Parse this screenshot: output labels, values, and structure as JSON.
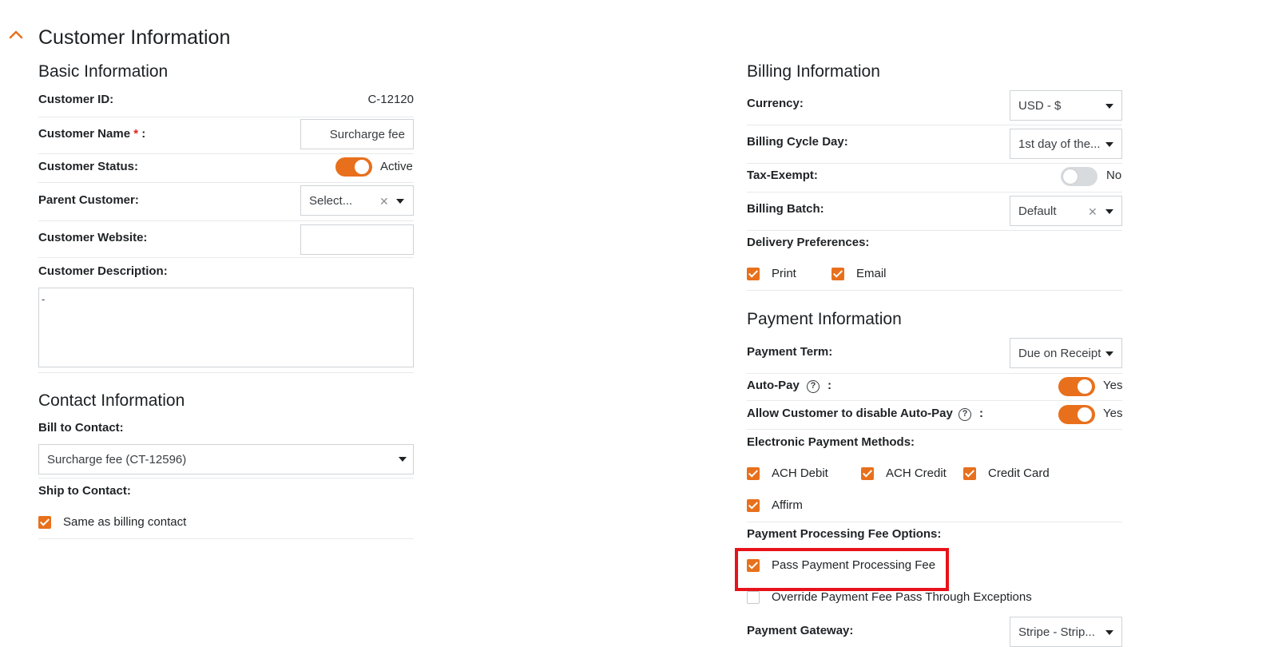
{
  "page": {
    "title": "Customer Information"
  },
  "basic": {
    "title": "Basic Information",
    "customer_id_label": "Customer ID:",
    "customer_id_value": "C-12120",
    "customer_name_label": "Customer Name",
    "required_mark": "*",
    "colon": ":",
    "customer_name_value": "Surcharge fee",
    "status_label": "Customer Status:",
    "status_value": "Active",
    "parent_label": "Parent Customer:",
    "parent_placeholder": "Select...",
    "website_label": "Customer Website:",
    "website_value": "",
    "description_label": "Customer Description:",
    "description_value": "-"
  },
  "contact": {
    "title": "Contact Information",
    "bill_label": "Bill to Contact:",
    "bill_value": "Surcharge fee (CT-12596)",
    "ship_label": "Ship to Contact:",
    "same_as_billing": "Same as billing contact"
  },
  "billing": {
    "title": "Billing Information",
    "currency_label": "Currency:",
    "currency_value": "USD - $",
    "cycle_label": "Billing Cycle Day:",
    "cycle_value": "1st day of the...",
    "tax_label": "Tax-Exempt:",
    "tax_value": "No",
    "batch_label": "Billing Batch:",
    "batch_value": "Default",
    "delivery_label": "Delivery Preferences:",
    "delivery_print": "Print",
    "delivery_email": "Email"
  },
  "payment": {
    "title": "Payment Information",
    "term_label": "Payment Term:",
    "term_value": "Due on Receipt",
    "autopay_label": "Auto-Pay",
    "autopay_value": "Yes",
    "allow_disable_label": "Allow Customer to disable Auto-Pay",
    "allow_disable_value": "Yes",
    "methods_label": "Electronic Payment Methods:",
    "method_ach_debit": "ACH Debit",
    "method_ach_credit": "ACH Credit",
    "method_credit_card": "Credit Card",
    "method_affirm": "Affirm",
    "fee_options_label": "Payment Processing Fee Options:",
    "pass_fee": "Pass Payment Processing Fee",
    "override_fee": "Override Payment Fee Pass Through Exceptions",
    "gateway_label": "Payment Gateway:",
    "gateway_value": "Stripe - Strip..."
  },
  "icons": {
    "collapse": "chevron-up-icon",
    "caret": "caret-down-icon",
    "clear": "clear-x-icon",
    "help": "question-circle-icon",
    "check": "checkbox-checked-icon"
  },
  "colors": {
    "accent": "#e8701c",
    "highlight": "#e8121a"
  }
}
